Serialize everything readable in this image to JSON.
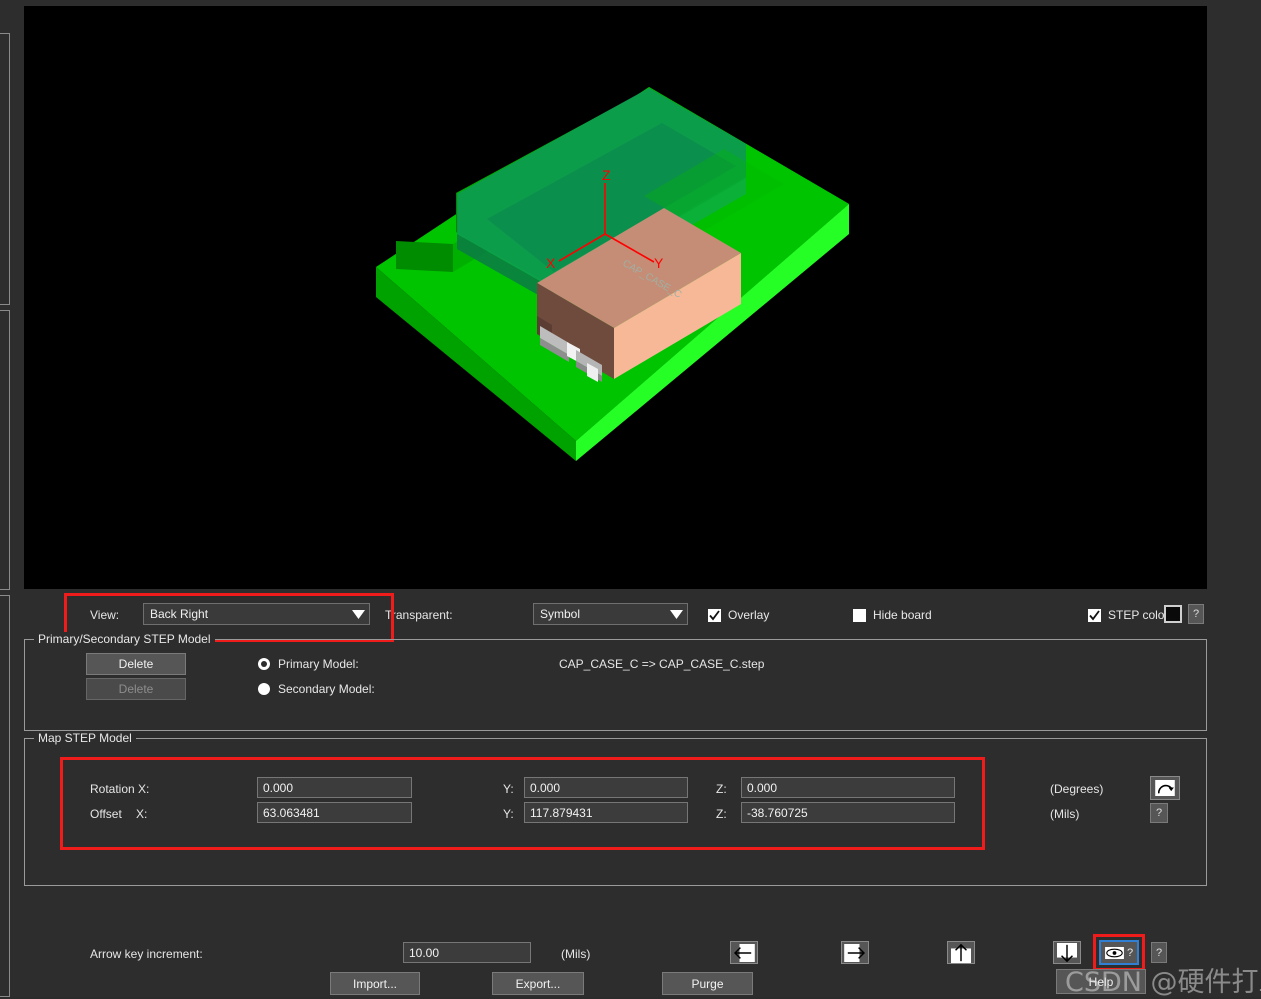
{
  "viewport": {
    "model_label": "CAP_CASE_C",
    "axis_labels": {
      "x": "X",
      "y": "Y",
      "z": "Z"
    },
    "colors": {
      "background": "#000000",
      "board_top": "#00d400",
      "board_front": "#00b400",
      "board_side": "#009000",
      "overlay_translucent": "#0d8a52",
      "component_top": "#c08a72",
      "component_front": "#f4b593",
      "component_side": "#6b4a3e",
      "terminal": "#c8c8c8",
      "axis": "#ff0000"
    }
  },
  "toolbar": {
    "view_label": "View:",
    "view_value": "Back Right",
    "transparent_label": "Transparent:",
    "transparent_value": "Symbol",
    "overlay_label": "Overlay",
    "overlay_checked": true,
    "hide_board_label": "Hide board",
    "hide_board_checked": false,
    "step_color_label": "STEP color",
    "step_color_checked": true,
    "step_color_value": "#0a0a0a",
    "help_q": "?"
  },
  "primary_secondary_group": {
    "title": "Primary/Secondary STEP Model",
    "delete_primary_label": "Delete",
    "delete_secondary_label": "Delete",
    "delete_secondary_disabled": true,
    "primary_model_label": "Primary Model:",
    "primary_model_selected": true,
    "secondary_model_label": "Secondary Model:",
    "secondary_model_selected": false,
    "primary_model_file": "CAP_CASE_C => CAP_CASE_C.step",
    "secondary_model_file": ""
  },
  "map_step_group": {
    "title": "Map STEP Model",
    "rotation_label": "Rotation X:",
    "rotation_x": "0.000",
    "rotation_y_label": "Y:",
    "rotation_y": "0.000",
    "rotation_z_label": "Z:",
    "rotation_z": "0.000",
    "offset_label": "Offset",
    "offset_x_label": "X:",
    "offset_x": "63.063481",
    "offset_y_label": "Y:",
    "offset_y": "117.879431",
    "offset_z_label": "Z:",
    "offset_z": "-38.760725",
    "degrees_unit": "(Degrees)",
    "mils_unit": "(Mils)",
    "rotate_icon_name": "rotate-arc-icon",
    "help_q": "?"
  },
  "bottom": {
    "arrow_increment_label": "Arrow key increment:",
    "arrow_increment_value": "10.00",
    "arrow_increment_unit": "(Mils)",
    "import_label": "Import...",
    "export_label": "Export...",
    "purge_label": "Purge",
    "help_label": "Help",
    "mirror_left_name": "mirror-left-icon",
    "mirror_right_name": "mirror-right-icon",
    "mirror_up_name": "mirror-up-icon",
    "mirror_down_name": "mirror-down-icon",
    "preview_q": "?",
    "help_q": "?"
  },
  "watermark": {
    "text": "CSDN @硬件打工人"
  }
}
